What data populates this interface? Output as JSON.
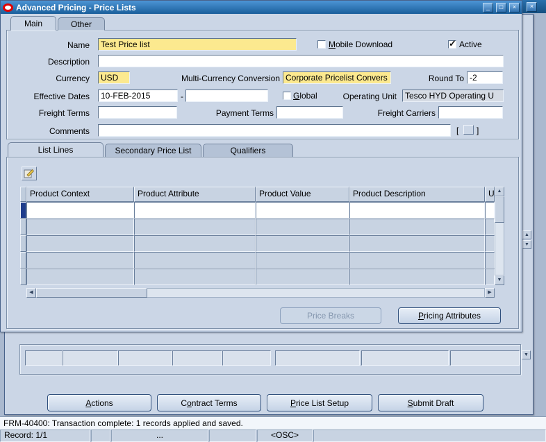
{
  "window": {
    "title": "Advanced Pricing - Price Lists"
  },
  "tabs": {
    "main": "Main",
    "other": "Other"
  },
  "form": {
    "name_label": "Name",
    "name_value": "Test Price list",
    "mobile_download_label": "Mobile Download",
    "active_label": "Active",
    "description_label": "Description",
    "description_value": "",
    "currency_label": "Currency",
    "currency_value": "USD",
    "multi_currency_label": "Multi-Currency Conversion",
    "multi_currency_value": "Corporate Pricelist Convers",
    "round_to_label": "Round To",
    "round_to_value": "-2",
    "effective_dates_label": "Effective Dates",
    "effective_from": "10-FEB-2015",
    "effective_to": "",
    "date_separator": "-",
    "global_label": "Global",
    "operating_unit_label": "Operating Unit",
    "operating_unit_value": "Tesco HYD Operating U",
    "freight_terms_label": "Freight Terms",
    "freight_terms_value": "",
    "payment_terms_label": "Payment Terms",
    "payment_terms_value": "",
    "freight_carriers_label": "Freight Carriers",
    "freight_carriers_value": "",
    "comments_label": "Comments",
    "comments_value": "",
    "bracket_open": "[",
    "bracket_close": "]"
  },
  "checkbox_states": {
    "mobile_download": false,
    "active": true,
    "global": false
  },
  "line_tabs": {
    "list_lines": "List Lines",
    "secondary_price_list": "Secondary Price List",
    "qualifiers": "Qualifiers"
  },
  "lines_table": {
    "columns": [
      "Product Context",
      "Product Attribute",
      "Product Value",
      "Product Description",
      "U"
    ]
  },
  "lines_buttons": {
    "price_breaks": "Price Breaks",
    "pricing_attributes": "Pricing Attributes"
  },
  "parent_buttons": {
    "actions": "Actions",
    "contract_terms": "Contract Terms",
    "price_list_setup": "Price List Setup",
    "submit_draft": "Submit Draft"
  },
  "status_bar": {
    "message": "FRM-40400: Transaction complete: 1 records applied and saved."
  },
  "record_bar": {
    "record": "Record: 1/1",
    "more": "...",
    "osc": "<OSC>"
  },
  "colors": {
    "titlebar": "#1a5f9b",
    "required_field": "#fce98f",
    "window": "#cbd6e6"
  }
}
